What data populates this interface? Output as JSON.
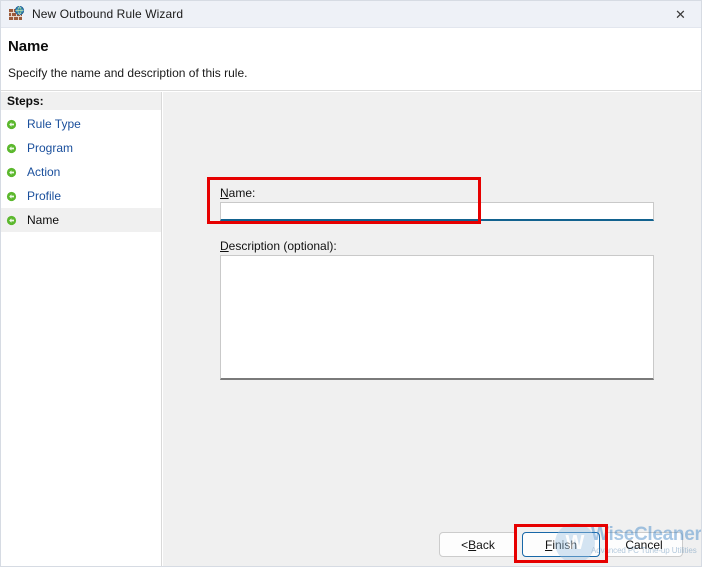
{
  "window": {
    "title": "New Outbound Rule Wizard",
    "icon": "firewall-brickwall-globe-icon",
    "close_label": "✕"
  },
  "header": {
    "title": "Name",
    "subtitle": "Specify the name and description of this rule."
  },
  "sidebar": {
    "heading": "Steps:",
    "items": [
      {
        "label": "Rule Type",
        "current": false
      },
      {
        "label": "Program",
        "current": false
      },
      {
        "label": "Action",
        "current": false
      },
      {
        "label": "Profile",
        "current": false
      },
      {
        "label": "Name",
        "current": true
      }
    ]
  },
  "main": {
    "name_field": {
      "label_accel": "N",
      "label_rest": "ame:",
      "value": "",
      "placeholder": ""
    },
    "description_field": {
      "label_accel": "D",
      "label_rest": "escription (optional):",
      "value": "",
      "placeholder": ""
    }
  },
  "footer": {
    "back": {
      "prefix": "< ",
      "accel": "B",
      "rest": "ack"
    },
    "finish": {
      "prefix": "",
      "accel": "F",
      "rest": "inish"
    },
    "cancel": {
      "prefix": "",
      "accel": "",
      "rest": "Cancel"
    }
  },
  "watermark": {
    "logo_letter": "W",
    "name": "WiseCleaner",
    "tagline": "Advanced PC Tune-up Utilities"
  },
  "colors": {
    "titlebar_bg": "#eef1f7",
    "panel_bg": "#f0f0f0",
    "link_blue": "#1a4f9c",
    "focus_teal": "#12628f",
    "annotation_red": "#e60000",
    "brand_blue": "#2f7cc4",
    "step_bullet_green": "#4caf2a"
  }
}
